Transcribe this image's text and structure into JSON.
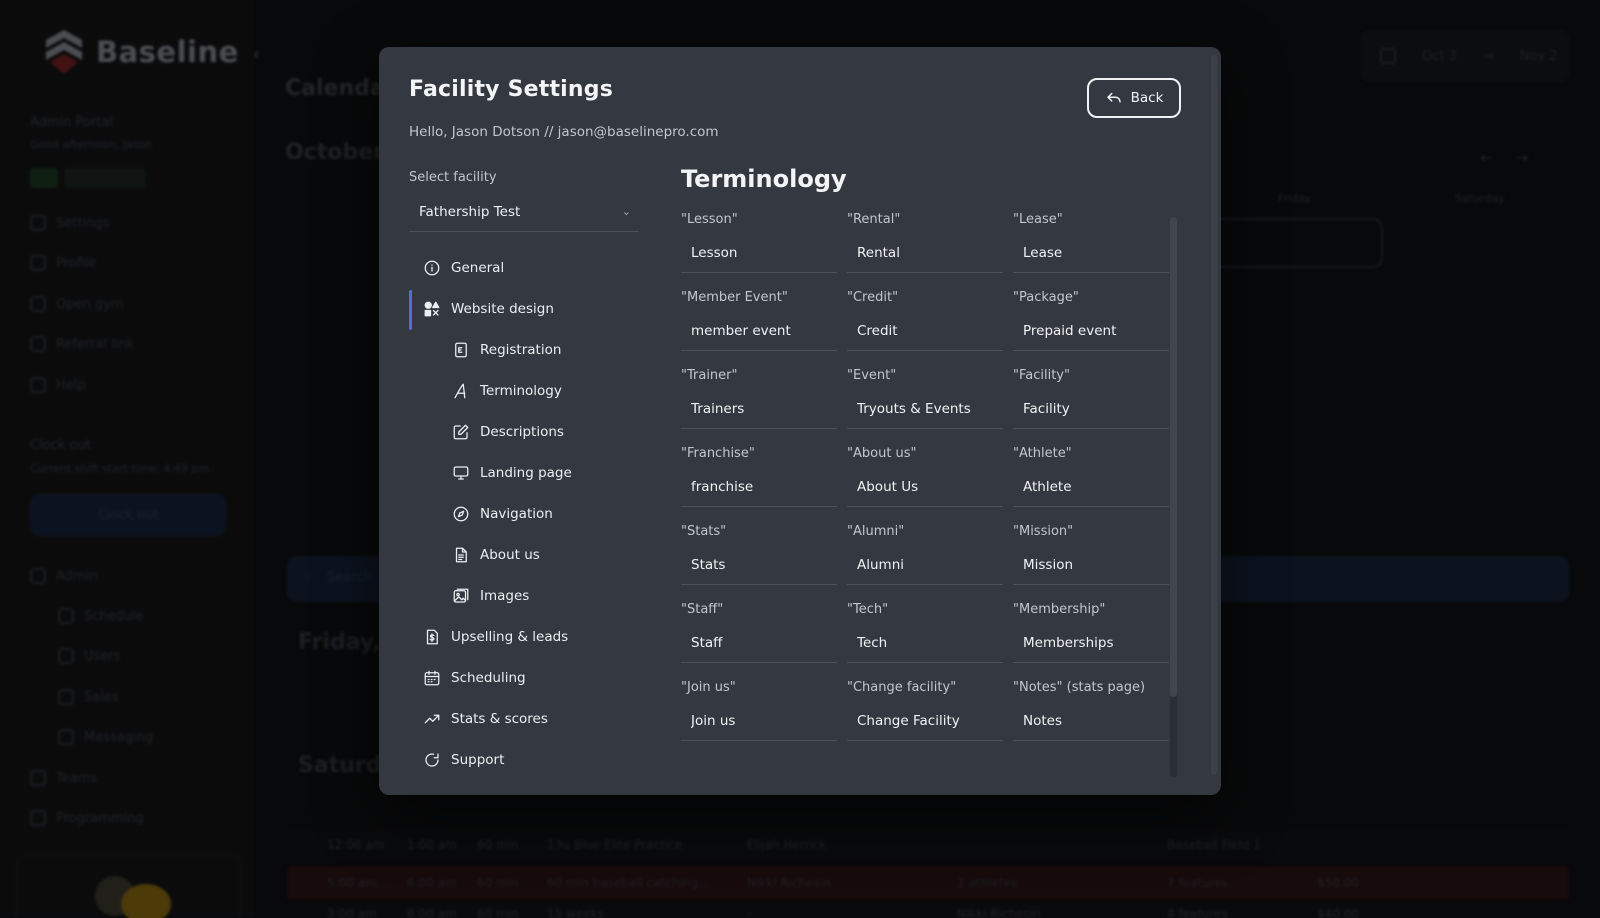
{
  "background_app": {
    "brand": "Baseline",
    "portal_title": "Admin Portal",
    "greeting": "Good afternoon, Jason",
    "sidebar_items": [
      "Settings",
      "Profile",
      "Open gym",
      "Referral link",
      "Help"
    ],
    "clock_section": "Clock out",
    "clock_shift_text": "Current shift start time: 4:49 pm",
    "clock_button": "Clock out",
    "admin_section": "Admin",
    "admin_items": [
      "Schedule",
      "Users",
      "Sales",
      "Messaging"
    ],
    "teams": "Teams",
    "programming": "Programming",
    "page_title": "Calendar",
    "month": "October",
    "date_from": "Oct 3",
    "date_to": "Nov 2",
    "weekday_friday": "Friday",
    "weekday_saturday": "Saturday",
    "search_placeholder": "Search",
    "day_friday": "Friday,",
    "day_saturday": "Saturday",
    "rows": [
      {
        "start": "12:00 am",
        "end": "1:00 am",
        "min": "60 min",
        "name": "13u Blue Elite Practice",
        "trainer": "Elijah Herrick",
        "facility": "Baseball Field 1"
      },
      {
        "start": "5:00 am",
        "end": "6:00 am",
        "min": "60 min",
        "name": "60 min baseball catching...",
        "trainer": "Nikki Richesin",
        "athletes": "2 athletes",
        "features": "7 features",
        "cost": "$50.00"
      },
      {
        "start": "3:00 am",
        "end": "6:00 am",
        "min": "60 min",
        "name": "15 weeks",
        "trainer": "-",
        "athletes": "Nikki Richesin",
        "features": "4 features",
        "cost": "$40.00"
      }
    ]
  },
  "modal": {
    "title": "Facility Settings",
    "subtitle": "Hello, Jason Dotson // jason@baselinepro.com",
    "back_label": "Back",
    "select_label": "Select facility",
    "selected_facility": "Fathership Test",
    "nav": [
      {
        "label": "General",
        "icon": "info-icon",
        "level": "top"
      },
      {
        "label": "Website design",
        "icon": "shapes-icon",
        "level": "top",
        "active": true
      },
      {
        "label": "Registration",
        "icon": "registration-icon",
        "level": "sub"
      },
      {
        "label": "Terminology",
        "icon": "font-icon",
        "level": "sub"
      },
      {
        "label": "Descriptions",
        "icon": "edit-icon",
        "level": "sub"
      },
      {
        "label": "Landing page",
        "icon": "monitor-icon",
        "level": "sub"
      },
      {
        "label": "Navigation",
        "icon": "compass-icon",
        "level": "sub"
      },
      {
        "label": "About us",
        "icon": "document-icon",
        "level": "sub"
      },
      {
        "label": "Images",
        "icon": "images-icon",
        "level": "sub"
      },
      {
        "label": "Upselling & leads",
        "icon": "dollar-file-icon",
        "level": "top"
      },
      {
        "label": "Scheduling",
        "icon": "calendar-icon",
        "level": "top"
      },
      {
        "label": "Stats & scores",
        "icon": "trending-up-icon",
        "level": "top"
      },
      {
        "label": "Support",
        "icon": "support-icon",
        "level": "top"
      }
    ],
    "section_title": "Terminology",
    "terms": [
      {
        "label": "\"Lesson\"",
        "value": "Lesson"
      },
      {
        "label": "\"Rental\"",
        "value": "Rental"
      },
      {
        "label": "\"Lease\"",
        "value": "Lease"
      },
      {
        "label": "\"Member Event\"",
        "value": "member event"
      },
      {
        "label": "\"Credit\"",
        "value": "Credit"
      },
      {
        "label": "\"Package\"",
        "value": "Prepaid event"
      },
      {
        "label": "\"Trainer\"",
        "value": "Trainers"
      },
      {
        "label": "\"Event\"",
        "value": "Tryouts & Events"
      },
      {
        "label": "\"Facility\"",
        "value": "Facility"
      },
      {
        "label": "\"Franchise\"",
        "value": "franchise"
      },
      {
        "label": "\"About us\"",
        "value": "About Us"
      },
      {
        "label": "\"Athlete\"",
        "value": "Athlete"
      },
      {
        "label": "\"Stats\"",
        "value": "Stats"
      },
      {
        "label": "\"Alumni\"",
        "value": "Alumni"
      },
      {
        "label": "\"Mission\"",
        "value": "Mission"
      },
      {
        "label": "\"Staff\"",
        "value": "Staff"
      },
      {
        "label": "\"Tech\"",
        "value": "Tech"
      },
      {
        "label": "\"Membership\"",
        "value": "Memberships"
      },
      {
        "label": "\"Join us\"",
        "value": "Join us"
      },
      {
        "label": "\"Change facility\"",
        "value": "Change Facility"
      },
      {
        "label": "\"Notes\" (stats page)",
        "value": "Notes"
      }
    ]
  },
  "colors": {
    "modal_bg": "#343840",
    "accent": "#4f6fd6",
    "text": "#f1f2f4"
  }
}
